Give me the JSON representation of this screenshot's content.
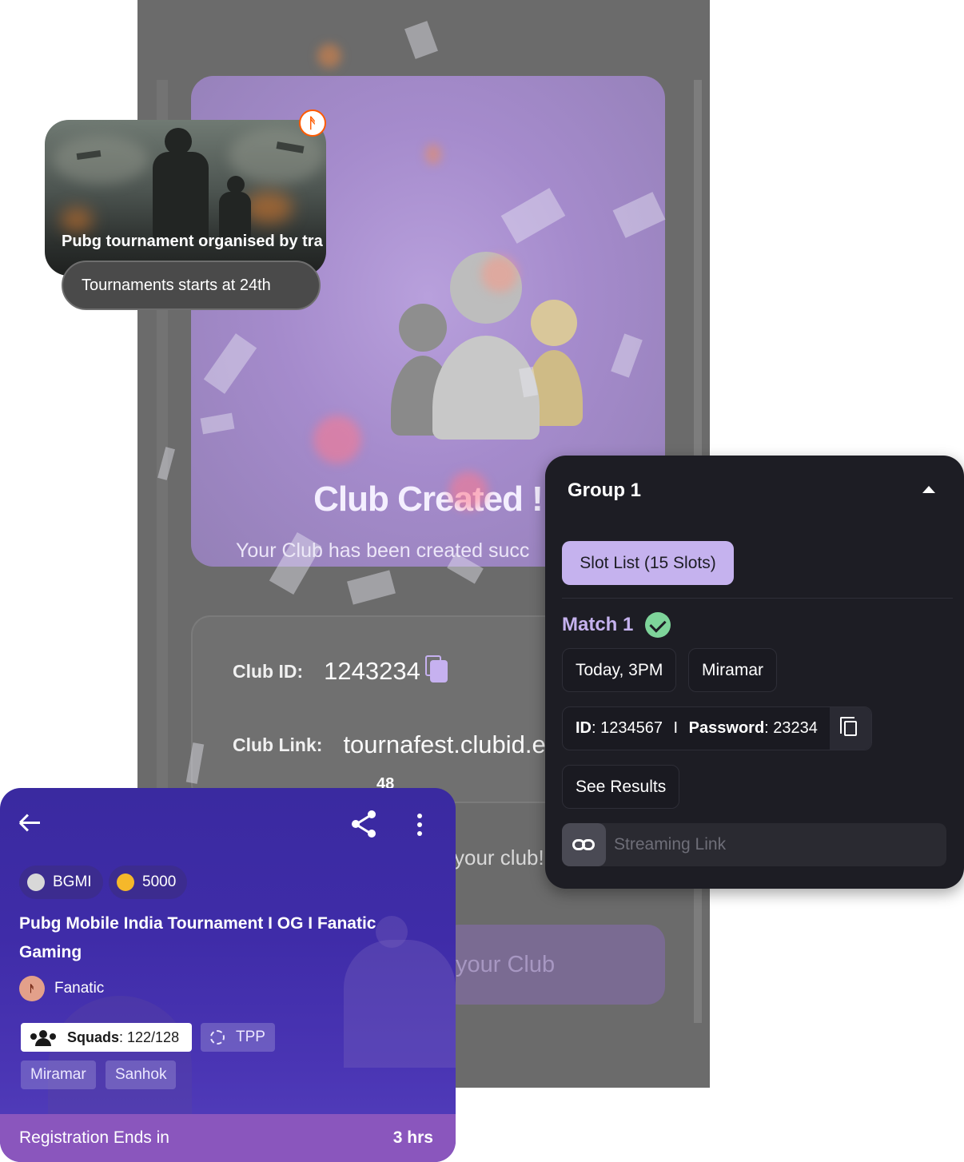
{
  "colors": {
    "accent_lavender": "#c5b2ee",
    "panel_dark": "#1d1d24",
    "detail_purple": "#3f2ca8",
    "registration_bar": "#8a56bd",
    "success_green": "#7ed49a"
  },
  "background_screen": {
    "hero_title": "Club Created !",
    "hero_subtitle": "Your Club has been created succ",
    "club_id_label": "Club ID:",
    "club_id_value": "1243234",
    "club_link_label": "Club Link:",
    "club_link_value": "tournafest.clubid.e",
    "invite_text": "your club!",
    "cta_label": "your Club"
  },
  "promo_card": {
    "title": "Pubg  tournament organised by tra",
    "badge": "Tournaments starts at 24th",
    "logo_icon": "fnatic-logo-icon"
  },
  "group_panel": {
    "title": "Group 1",
    "slot_list_label": "Slot List (15 Slots)",
    "match_title": "Match 1",
    "match_time": "Today, 3PM",
    "match_map": "Miramar",
    "id_label": "ID",
    "id_value": ": 1234567",
    "separator": "I",
    "password_label": "Password",
    "password_value": ": 23234",
    "see_results_label": "See Results",
    "streaming_placeholder": "Streaming Link"
  },
  "tournament_detail": {
    "peek_number": "48",
    "game_label": "BGMI",
    "prize_value": "5000",
    "title": "Pubg Mobile India Tournament I OG I Fanatic Gaming",
    "organizer": "Fanatic",
    "squads_label": "Squads",
    "squads_value": ": 122/128",
    "perspective_label": "TPP",
    "maps": [
      "Miramar",
      "Sanhok"
    ],
    "registration_label": "Registration Ends in",
    "registration_value": "3 hrs"
  }
}
